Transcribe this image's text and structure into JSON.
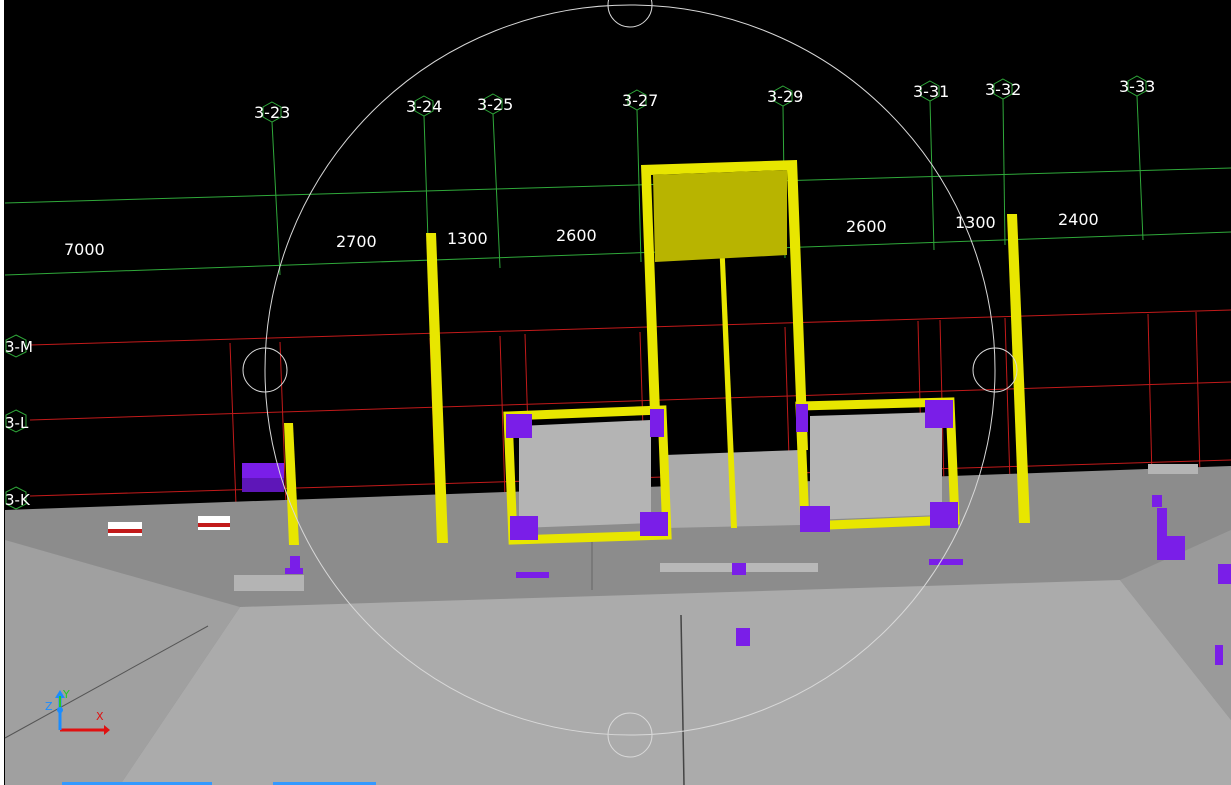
{
  "viewport": {
    "background": "#000000",
    "colors": {
      "grid_green": "#2fa83a",
      "grid_red": "#c21a1a",
      "column_yellow": "#e8e600",
      "column_dark_yellow": "#b8b400",
      "corner_purple": "#7a1ee8",
      "slab_grey": "#ababab",
      "floor_grey": "#8c8c8c",
      "orbit_ring": "#d8d8d8"
    }
  },
  "grid_axes": [
    {
      "label": "3-23"
    },
    {
      "label": "3-24"
    },
    {
      "label": "3-25"
    },
    {
      "label": "3-27"
    },
    {
      "label": "3-29"
    },
    {
      "label": "3-31"
    },
    {
      "label": "3-32"
    },
    {
      "label": "3-33"
    }
  ],
  "grid_rows": [
    {
      "label": "3-M"
    },
    {
      "label": "3-L"
    },
    {
      "label": "3-K"
    }
  ],
  "dimensions": [
    "7000",
    "2700",
    "1300",
    "2600",
    "2600",
    "1300",
    "2400"
  ],
  "ucs": {
    "x_label": "X",
    "y_label": "Y",
    "z_label": "Z",
    "icon": "ucs-axes-icon"
  },
  "orbit": {
    "icon": "orbit-ring-icon"
  }
}
